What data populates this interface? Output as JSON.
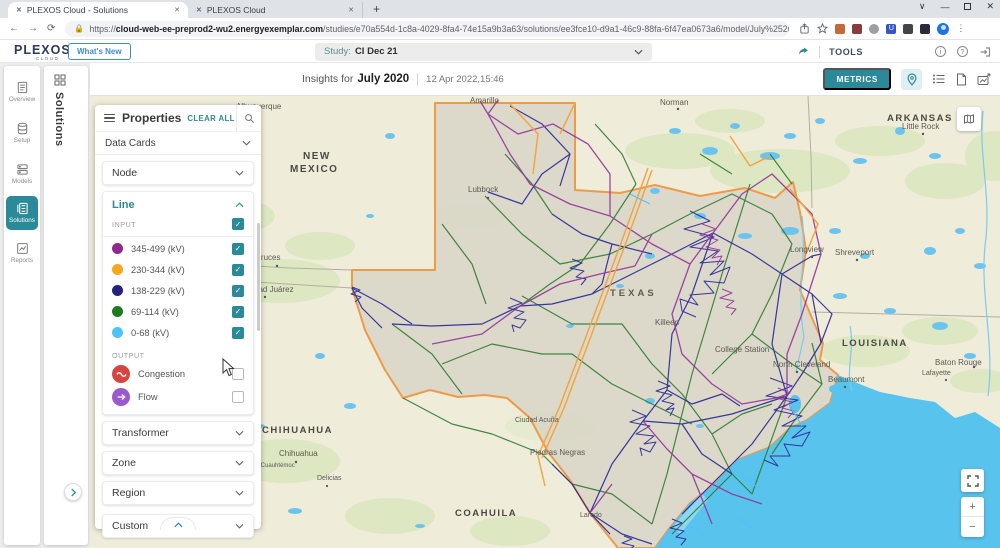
{
  "browser": {
    "tabs": [
      "PLEXOS Cloud - Solutions",
      "PLEXOS Cloud"
    ],
    "url_protocol": "https://",
    "url_domain": "cloud-web-ee-preprod2-wu2.energyexemplar.com",
    "url_path": "/studies/e70a554d-1c8a-4029-8fa4-74e15a9b3a63/solutions/ee3fce10-d9a1-46c9-88fa-6f47ea0673a6/model/July%25202020?view=map"
  },
  "header": {
    "logo": "PLEXOS",
    "logo_sub": "CLOUD",
    "whats_new": "What's New",
    "study_label": "Study:",
    "study_value": "CI Dec 21",
    "tools": "TOOLS"
  },
  "nav": {
    "items": [
      "Overview",
      "Setup",
      "Models",
      "Solutions",
      "Reports"
    ]
  },
  "drawer": {
    "title": "Solutions"
  },
  "toolbar": {
    "insights_prefix": "Insights for",
    "period": "July 2020",
    "timestamp": "12 Apr 2022,15:46",
    "metrics": "METRICS"
  },
  "panel": {
    "title": "Properties",
    "clear_all": "CLEAR ALL",
    "data_cards_label": "Data Cards",
    "node_label": "Node",
    "line_label": "Line",
    "transformer_label": "Transformer",
    "zone_label": "Zone",
    "region_label": "Region",
    "custom_label": "Custom",
    "input_label": "INPUT",
    "output_label": "OUTPUT",
    "input_all_checked": true,
    "voltages": [
      {
        "label": "345-499 (kV)",
        "color": "#8e2a8b",
        "checked": true
      },
      {
        "label": "230-344 (kV)",
        "color": "#f5a71d",
        "checked": true
      },
      {
        "label": "138-229 (kV)",
        "color": "#23237e",
        "checked": true
      },
      {
        "label": "69-114 (kV)",
        "color": "#1e7a1e",
        "checked": true
      },
      {
        "label": "0-68 (kV)",
        "color": "#4fc3f7",
        "checked": true
      }
    ],
    "outputs": [
      {
        "label": "Congestion",
        "color": "#d64541",
        "checked": false
      },
      {
        "label": "Flow",
        "color": "#9b59d0",
        "checked": false
      }
    ]
  },
  "map": {
    "states": [
      "NEW",
      "MEXICO",
      "TEXAS",
      "ARKANSAS",
      "LOUISIANA",
      "CHIHUAHUA",
      "COAHUILA"
    ],
    "cities": [
      "Albuquerque",
      "Amarillo",
      "Norman",
      "Little Rock",
      "Lubbock",
      "Las Cruces",
      "Ciudad Juárez",
      "Longview",
      "Shreveport",
      "Killeen",
      "College Station",
      "North Cleveland",
      "Beaumont",
      "Baton Rouge",
      "Lafayette",
      "Chihuahua",
      "Ciudad Cuauhtémoc",
      "Delicias",
      "Ciudad Acuña",
      "Piedras Negras",
      "Laredo"
    ],
    "texas_border_color": "#ef9a47"
  },
  "colors": {
    "accent": "#2b8a99"
  }
}
